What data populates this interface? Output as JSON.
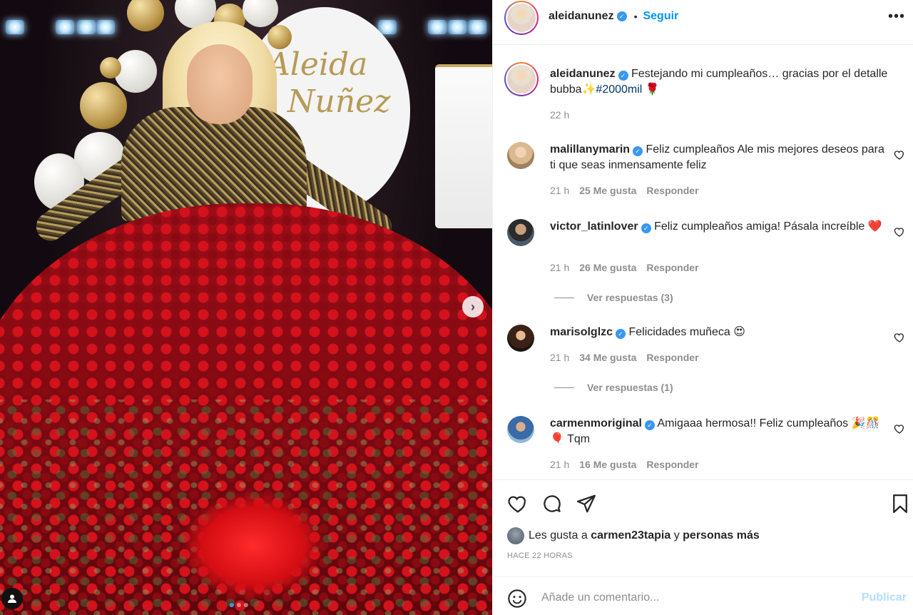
{
  "post": {
    "username": "aleidanunez",
    "follow_label": "Seguir",
    "bullet": "•",
    "more_label": "•••"
  },
  "media": {
    "backdrop_line1": "Aleida",
    "backdrop_line2": "Nuñez",
    "next_label": "›",
    "slide_count": 3,
    "active_slide": 1
  },
  "caption": {
    "username": "aleidanunez",
    "text": "Festejando mi cumpleaños… gracias por el detalle bubba✨",
    "hashtag": "#2000mil",
    "emoji": "🌹",
    "time": "22 h"
  },
  "comments": [
    {
      "username": "malillanymarin",
      "verified": true,
      "text": "Feliz cumpleaños Ale mis mejores deseos para ti que seas inmensamente feliz",
      "time": "21 h",
      "likes": "25 Me gusta",
      "reply": "Responder"
    },
    {
      "username": "victor_latinlover",
      "verified": true,
      "text": "Feliz cumpleaños amiga! Pásala increíble ❤️",
      "time": "21 h",
      "likes": "26 Me gusta",
      "reply": "Responder",
      "replies": "Ver respuestas (3)"
    },
    {
      "username": "marisolglzc",
      "verified": true,
      "text": "Felicidades muñeca 😍",
      "time": "21 h",
      "likes": "34 Me gusta",
      "reply": "Responder",
      "replies": "Ver respuestas (1)"
    },
    {
      "username": "carmenmoriginal",
      "verified": true,
      "text": "Amigaaa hermosa!! Feliz cumpleaños 🎉🎊🎈 Tqm",
      "time": "21 h",
      "likes": "16 Me gusta",
      "reply": "Responder"
    }
  ],
  "likes": {
    "prefix": "Les gusta a",
    "user": "carmen23tapia",
    "connector": "y",
    "others": "personas más"
  },
  "time_ago": "HACE 22 HORAS",
  "add_comment": {
    "placeholder": "Añade un comentario...",
    "publish": "Publicar"
  },
  "colors": {
    "accent": "#0095f6",
    "verified": "#3897f0",
    "muted": "#8e8e8e",
    "publish_disabled": "#b2dffc"
  }
}
